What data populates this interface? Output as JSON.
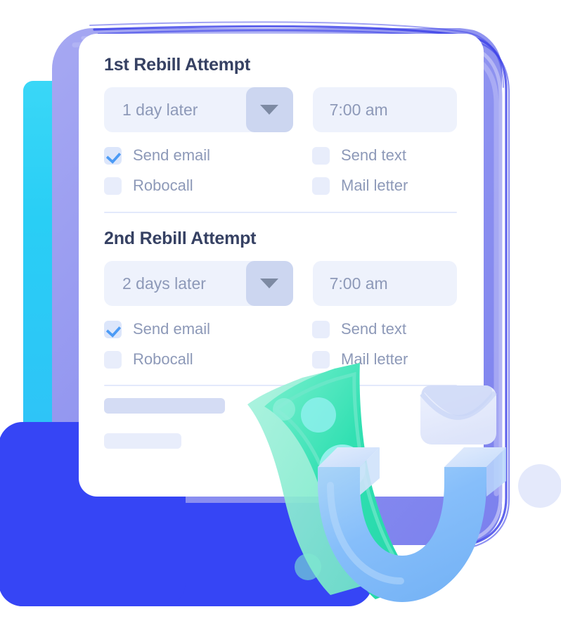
{
  "card": {
    "sections": [
      {
        "title": "1st Rebill Attempt",
        "delay": {
          "value": "1 day later",
          "caret_icon": "chevron-down-icon"
        },
        "time": {
          "value": "7:00 am"
        },
        "options": [
          {
            "label": "Send email",
            "checked": true
          },
          {
            "label": "Send text",
            "checked": false
          },
          {
            "label": "Robocall",
            "checked": false
          },
          {
            "label": "Mail letter",
            "checked": false
          }
        ]
      },
      {
        "title": "2nd Rebill Attempt",
        "delay": {
          "value": "2 days later",
          "caret_icon": "chevron-down-icon"
        },
        "time": {
          "value": "7:00 am"
        },
        "options": [
          {
            "label": "Send email",
            "checked": true
          },
          {
            "label": "Send text",
            "checked": false
          },
          {
            "label": "Robocall",
            "checked": false
          },
          {
            "label": "Mail letter",
            "checked": false
          }
        ]
      }
    ]
  },
  "colors": {
    "accent_blue": "#3645f5",
    "cyan": "#2ecdf5",
    "purple_frame": "#8f93f0",
    "check_blue": "#4c9bf5",
    "field_bg": "#eef2fc",
    "caret_bg": "#ccd6f0",
    "title_text": "#364163",
    "muted_text": "#8d99b8",
    "money_green": "#31e0b2",
    "magnet_blue": "#8ec5f5",
    "envelope_lavender": "#dfe5fa"
  },
  "illustration": {
    "items": [
      {
        "name": "money-bill-icon"
      },
      {
        "name": "envelope-icon"
      },
      {
        "name": "magnet-icon"
      },
      {
        "name": "circle-dot-decoration"
      }
    ]
  }
}
